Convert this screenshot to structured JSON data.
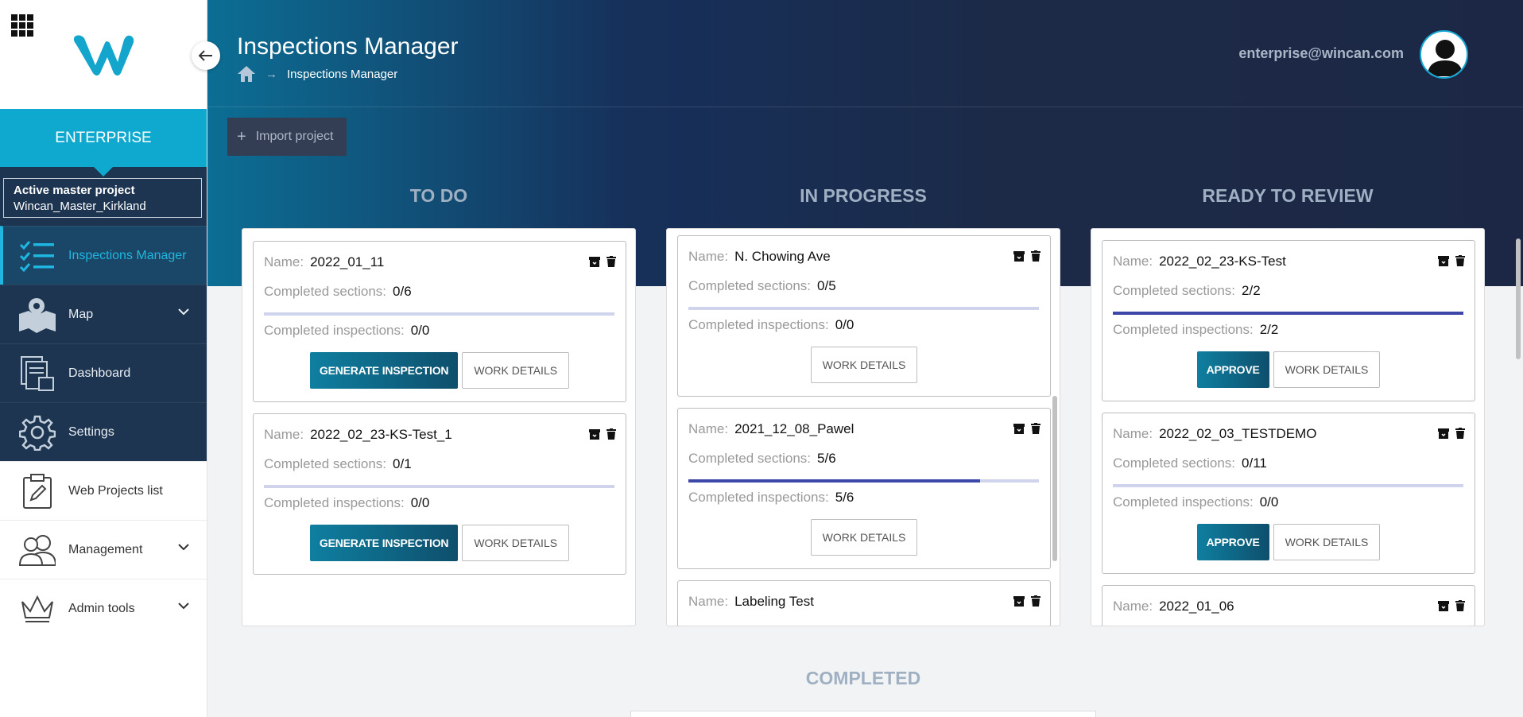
{
  "sidebar": {
    "enterprise_label": "ENTERPRISE",
    "master_project": {
      "title": "Active master project",
      "name": "Wincan_Master_Kirkland"
    },
    "items": [
      {
        "label": "Inspections Manager",
        "icon": "checklist-icon",
        "active": true
      },
      {
        "label": "Map",
        "icon": "map-icon"
      },
      {
        "label": "Dashboard",
        "icon": "dashboard-icon"
      },
      {
        "label": "Settings",
        "icon": "gear-icon"
      },
      {
        "label": "Web Projects list",
        "icon": "clipboard-icon"
      },
      {
        "label": "Management",
        "icon": "users-icon"
      },
      {
        "label": "Admin tools",
        "icon": "crown-icon"
      }
    ]
  },
  "header": {
    "title": "Inspections Manager",
    "breadcrumb": [
      "Inspections Manager"
    ],
    "user_email": "enterprise@wincan.com",
    "import_label": "Import project"
  },
  "labels": {
    "name": "Name:",
    "completed_sections": "Completed sections:",
    "completed_inspections": "Completed inspections:",
    "generate": "GENERATE INSPECTION",
    "work_details": "WORK DETAILS",
    "approve": "APPROVE"
  },
  "columns": {
    "todo": {
      "title": "TO DO",
      "cards": [
        {
          "name": "2022_01_11",
          "sections": "0/6",
          "inspections": "0/0",
          "progress": 0
        },
        {
          "name": "2022_02_23-KS-Test_1",
          "sections": "0/1",
          "inspections": "0/0",
          "progress": 0
        }
      ]
    },
    "in_progress": {
      "title": "IN PROGRESS",
      "cards": [
        {
          "name": "N. Chowing Ave",
          "sections": "0/5",
          "inspections": "0/0",
          "progress": 0
        },
        {
          "name": "2021_12_08_Pawel",
          "sections": "5/6",
          "inspections": "5/6",
          "progress": 0.833
        },
        {
          "name": "Labeling Test"
        }
      ]
    },
    "review": {
      "title": "READY TO REVIEW",
      "cards": [
        {
          "name": "2022_02_23-KS-Test",
          "sections": "2/2",
          "inspections": "2/2",
          "progress": 1
        },
        {
          "name": "2022_02_03_TESTDEMO",
          "sections": "0/11",
          "inspections": "0/0",
          "progress": 0
        },
        {
          "name": "2022_01_06"
        }
      ]
    },
    "completed": {
      "title": "COMPLETED"
    }
  }
}
